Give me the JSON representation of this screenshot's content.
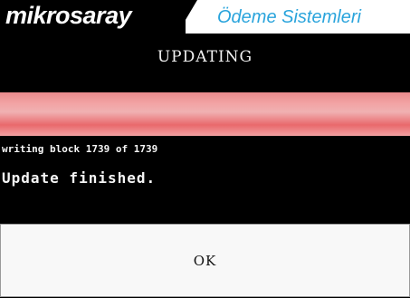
{
  "header": {
    "brand": "mikrosaray",
    "system_title": "Ödeme Sistemleri",
    "brand_color": "#2aa4dc"
  },
  "status": {
    "title": "UPDATING"
  },
  "progress": {
    "fraction": 1.0,
    "fill_color": "#f2a3a4"
  },
  "log": {
    "line1": "writing block 1739 of 1739",
    "line2": "Update finished."
  },
  "actions": {
    "ok_label": "OK"
  }
}
